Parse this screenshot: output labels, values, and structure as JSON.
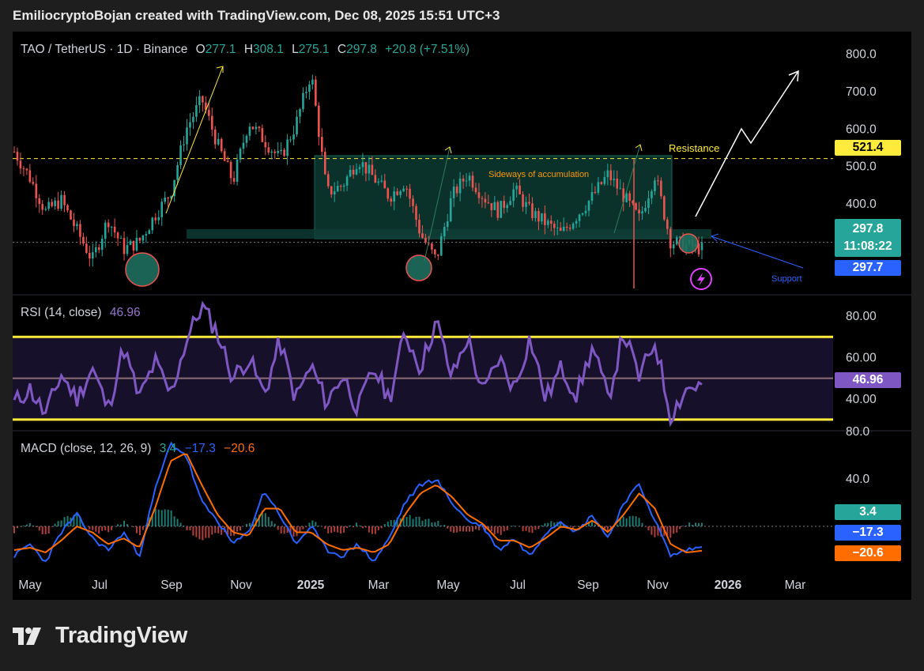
{
  "header": {
    "text": "EmiliocryptoBojan created with TradingView.com, Dec 08, 2025 15:51 UTC+3"
  },
  "brand": {
    "name": "TradingView",
    "logo_icon": "tradingview-logo-icon"
  },
  "colors": {
    "up": "#26a69a",
    "down": "#ef5350",
    "rsi": "#7e57c2",
    "macd": "#2962ff",
    "signal": "#ff6d00",
    "resistance": "#ffeb3b",
    "range_fill": "#0c3b33"
  },
  "price_legend": {
    "symbol": "TAO / TetherUS · 1D · Binance",
    "o_label": "O",
    "o": "277.1",
    "h_label": "H",
    "h": "308.1",
    "l_label": "L",
    "l": "275.1",
    "c_label": "C",
    "c": "297.8",
    "change": "+20.8 (+7.51%)"
  },
  "rsi_legend": {
    "label": "RSI (14, close)",
    "value": "46.96"
  },
  "macd_legend": {
    "label": "MACD (close, 12, 26, 9)",
    "hist": "3.4",
    "macd": "−17.3",
    "signal": "−20.6"
  },
  "tags": {
    "resistance": "521.4",
    "price": "297.8",
    "countdown": "11:08:22",
    "prev": "297.7",
    "rsi": "46.96",
    "hist": "3.4",
    "macd": "−17.3",
    "signal": "−20.6"
  },
  "annotations": {
    "resistance": "Resistance",
    "sideways": "Sideways of accumulation",
    "support": "Support",
    "flash_icon": "lightning-icon"
  },
  "chart_data": [
    {
      "type": "candlestick",
      "title": "TAO / TetherUS · 1D · Binance",
      "x_ticks": [
        "May",
        "Jul",
        "Sep",
        "Nov",
        "2025",
        "Mar",
        "May",
        "Jul",
        "Sep",
        "Nov",
        "2026",
        "Mar"
      ],
      "y_ticks": [
        "400.0",
        "500.0",
        "600.0",
        "700.0",
        "800.0"
      ],
      "ylim": [
        160,
        860
      ],
      "last": {
        "open": 277.1,
        "high": 308.1,
        "low": 275.1,
        "close": 297.8
      },
      "levels": {
        "resistance": 521.4,
        "support": 300
      },
      "series": [
        {
          "values": [
            540,
            470,
            380,
            410,
            330,
            250,
            360,
            280,
            300,
            370,
            430,
            600,
            680,
            560,
            460,
            620,
            570,
            520,
            610,
            750,
            430,
            450,
            520,
            470,
            420,
            460,
            320,
            250,
            420,
            480,
            420,
            380,
            440,
            380,
            350,
            320,
            370,
            420,
            480,
            420,
            360,
            480,
            300,
            290,
            280
          ]
        }
      ]
    },
    {
      "type": "line",
      "title": "RSI (14, close)",
      "y_ticks": [
        "40.00",
        "60.00",
        "80.00"
      ],
      "ylim": [
        25,
        90
      ],
      "bands": [
        30,
        50,
        70
      ],
      "series": [
        {
          "name": "RSI",
          "values": [
            38,
            45,
            32,
            52,
            40,
            55,
            35,
            65,
            40,
            58,
            42,
            68,
            85,
            72,
            50,
            60,
            42,
            68,
            40,
            56,
            38,
            52,
            35,
            55,
            40,
            72,
            55,
            78,
            50,
            70,
            42,
            60,
            45,
            70,
            40,
            55,
            42,
            65,
            40,
            72,
            50,
            68,
            32,
            45,
            47
          ]
        }
      ]
    },
    {
      "type": "line",
      "title": "MACD (close, 12, 26, 9)",
      "y_ticks": [
        "40.0",
        "80.0"
      ],
      "ylim": [
        -40,
        80
      ],
      "series": [
        {
          "name": "MACD",
          "values": [
            -25,
            -15,
            -30,
            -5,
            10,
            -10,
            -20,
            -5,
            -25,
            30,
            70,
            60,
            20,
            5,
            -15,
            -5,
            30,
            10,
            -15,
            0,
            -20,
            -25,
            -15,
            -30,
            -10,
            20,
            35,
            40,
            20,
            5,
            0,
            -20,
            -10,
            -25,
            -5,
            5,
            -5,
            10,
            -10,
            20,
            35,
            5,
            -25,
            -20,
            -17.3
          ]
        },
        {
          "name": "Signal",
          "values": [
            -20,
            -18,
            -22,
            -12,
            0,
            -5,
            -15,
            -10,
            -18,
            15,
            55,
            62,
            35,
            10,
            -5,
            -8,
            15,
            15,
            -5,
            -5,
            -15,
            -20,
            -18,
            -22,
            -15,
            10,
            28,
            35,
            25,
            10,
            2,
            -12,
            -12,
            -18,
            -10,
            0,
            -3,
            5,
            -5,
            10,
            28,
            15,
            -15,
            -22,
            -20.6
          ]
        }
      ]
    }
  ]
}
